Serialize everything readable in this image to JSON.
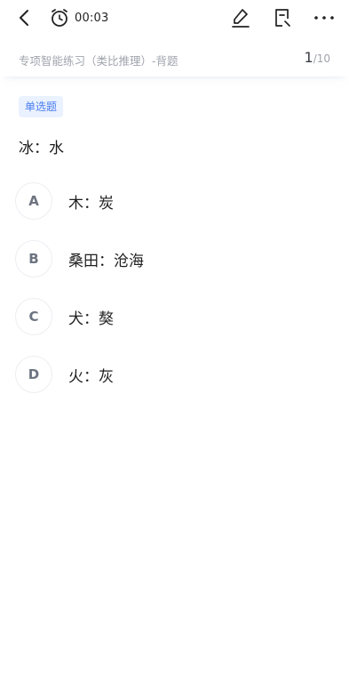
{
  "topbar": {
    "timer": "00:03"
  },
  "subheader": {
    "title": "专项智能练习（类比推理）-背题",
    "current": "1",
    "total": "/10"
  },
  "question": {
    "type_tag": "单选题",
    "stem": "冰：水",
    "options": [
      {
        "letter": "A",
        "text": "木：炭"
      },
      {
        "letter": "B",
        "text": "桑田：沧海"
      },
      {
        "letter": "C",
        "text": "犬：獒"
      },
      {
        "letter": "D",
        "text": "火：灰"
      }
    ]
  },
  "colors": {
    "accent": "#4a7df0",
    "tag_bg": "#eaf1ff",
    "muted": "#a0a4ad"
  },
  "icons": [
    "back-icon",
    "alarm-clock-icon",
    "pencil-icon",
    "notebook-icon",
    "more-icon"
  ]
}
